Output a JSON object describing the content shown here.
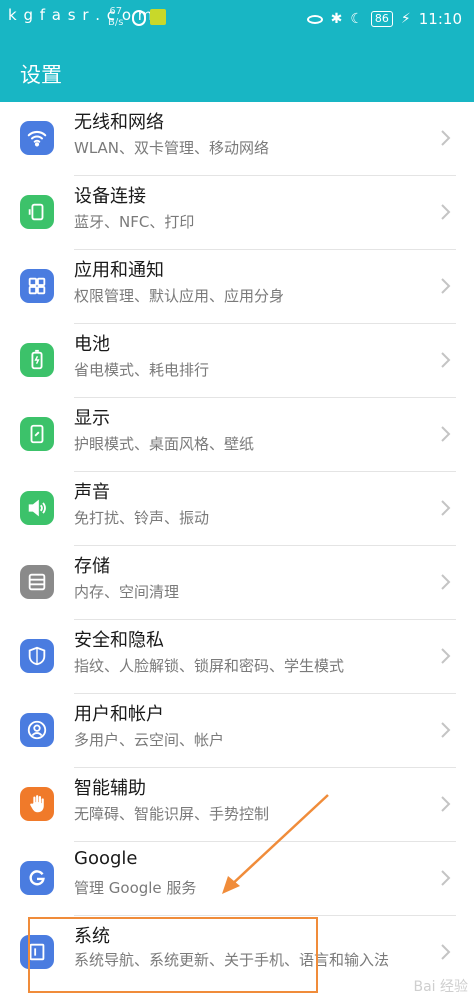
{
  "status_bar": {
    "left_text": "k g f a s r . c o m",
    "speed_value": "67",
    "speed_unit": "B/s",
    "battery": "86",
    "time": "11:10"
  },
  "header": {
    "title": "设置"
  },
  "settings": [
    {
      "title": "无线和网络",
      "subtitle": "WLAN、双卡管理、移动网络",
      "icon": "wifi-icon",
      "color": "#4a7ce0"
    },
    {
      "title": "设备连接",
      "subtitle": "蓝牙、NFC、打印",
      "icon": "device-connect-icon",
      "color": "#3cc26a"
    },
    {
      "title": "应用和通知",
      "subtitle": "权限管理、默认应用、应用分身",
      "icon": "apps-grid-icon",
      "color": "#4a7ce0"
    },
    {
      "title": "电池",
      "subtitle": "省电模式、耗电排行",
      "icon": "battery-icon",
      "color": "#3cc26a"
    },
    {
      "title": "显示",
      "subtitle": "护眼模式、桌面风格、壁纸",
      "icon": "display-icon",
      "color": "#3cc26a"
    },
    {
      "title": "声音",
      "subtitle": "免打扰、铃声、振动",
      "icon": "speaker-icon",
      "color": "#3cc26a"
    },
    {
      "title": "存储",
      "subtitle": "内存、空间清理",
      "icon": "storage-icon",
      "color": "#8a8a8a"
    },
    {
      "title": "安全和隐私",
      "subtitle": "指纹、人脸解锁、锁屏和密码、学生模式",
      "icon": "shield-icon",
      "color": "#4a7ce0"
    },
    {
      "title": "用户和帐户",
      "subtitle": "多用户、云空间、帐户",
      "icon": "user-icon",
      "color": "#4a7ce0"
    },
    {
      "title": "智能辅助",
      "subtitle": "无障碍、智能识屏、手势控制",
      "icon": "hand-icon",
      "color": "#f07a2a"
    },
    {
      "title": "Google",
      "subtitle": "管理 Google 服务",
      "icon": "google-icon",
      "color": "#4a7ce0"
    },
    {
      "title": "系统",
      "subtitle": "系统导航、系统更新、关于手机、语言和输入法",
      "icon": "system-icon",
      "color": "#4a7ce0"
    }
  ],
  "annotation_color": "#f08c3a",
  "watermark": "Bai 经验"
}
